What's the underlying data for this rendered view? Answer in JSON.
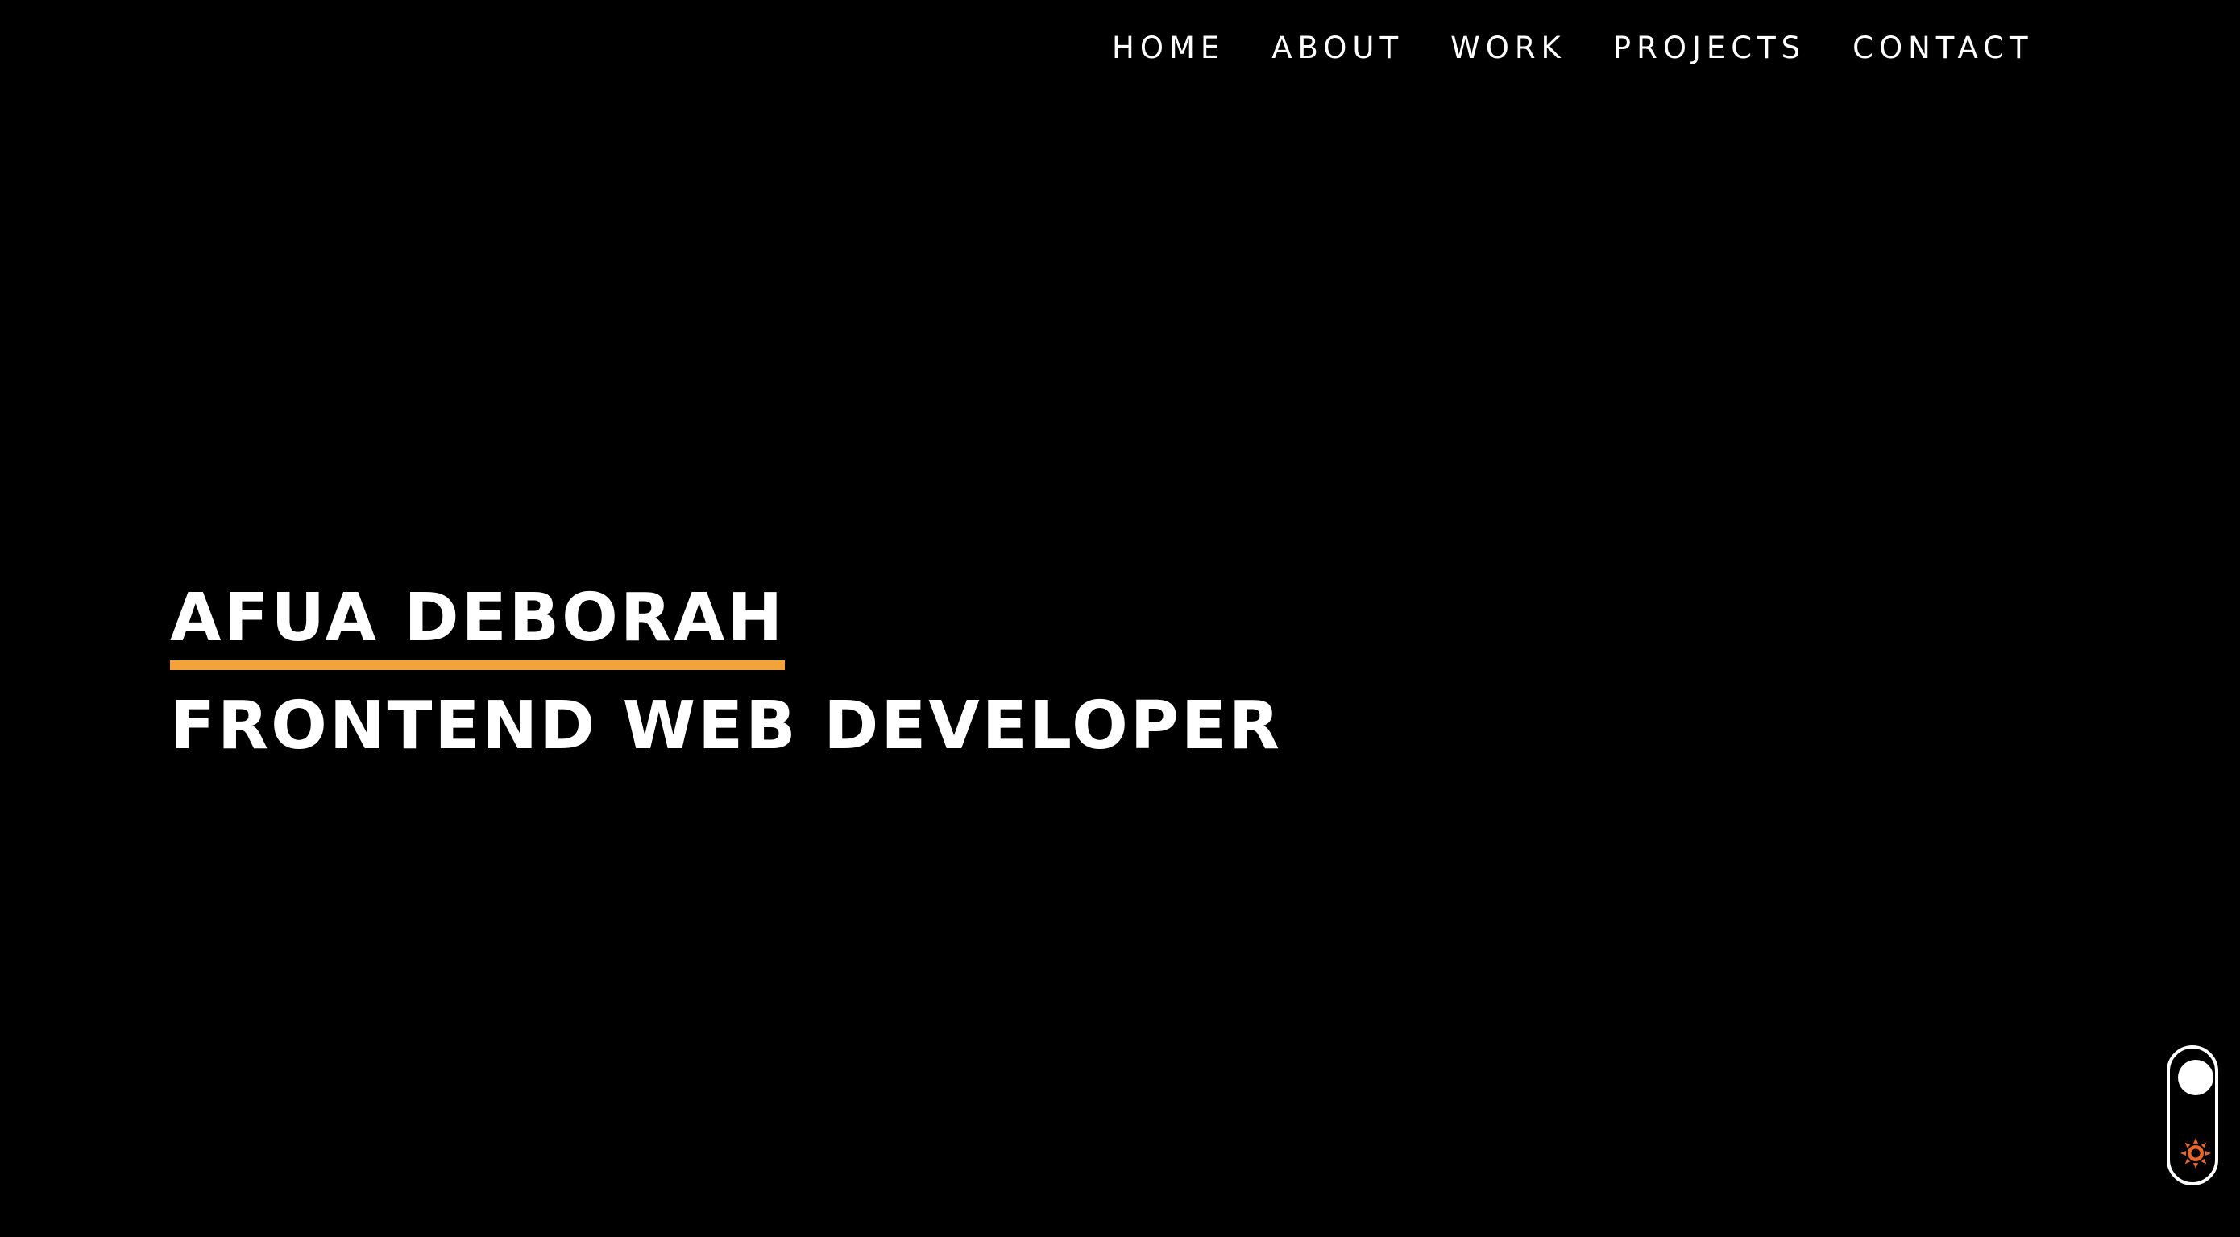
{
  "nav": {
    "items": [
      {
        "label": "HOME"
      },
      {
        "label": "ABOUT"
      },
      {
        "label": "WORK"
      },
      {
        "label": "PROJECTS"
      },
      {
        "label": "CONTACT"
      }
    ]
  },
  "hero": {
    "name": "AFUA DEBORAH",
    "role": "FRONTEND WEB DEVELOPER"
  },
  "theme_toggle": {
    "icon": "sun-icon",
    "mode": "dark"
  },
  "colors": {
    "background": "#000000",
    "text": "#ffffff",
    "accent": "#f2a33a",
    "sun": "#e8652c"
  }
}
